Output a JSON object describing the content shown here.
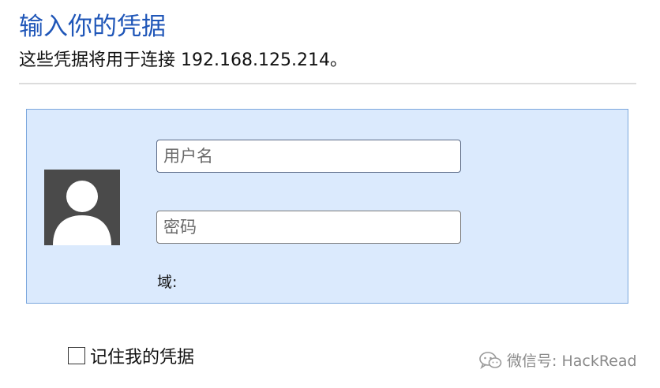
{
  "header": {
    "title": "输入你的凭据",
    "subtitle": "这些凭据将用于连接 192.168.125.214。"
  },
  "credentials": {
    "username_placeholder": "用户名",
    "password_placeholder": "密码",
    "domain_label": "域:"
  },
  "remember": {
    "label": "记住我的凭据",
    "checked": false
  },
  "watermark": {
    "text": "微信号: HackRead"
  },
  "icons": {
    "avatar": "user-avatar-icon",
    "wechat": "wechat-icon"
  },
  "colors": {
    "title": "#1f56b8",
    "panel_background": "#dbeafd",
    "panel_border": "#7ba7dd",
    "avatar_background": "#4a4a4a"
  }
}
